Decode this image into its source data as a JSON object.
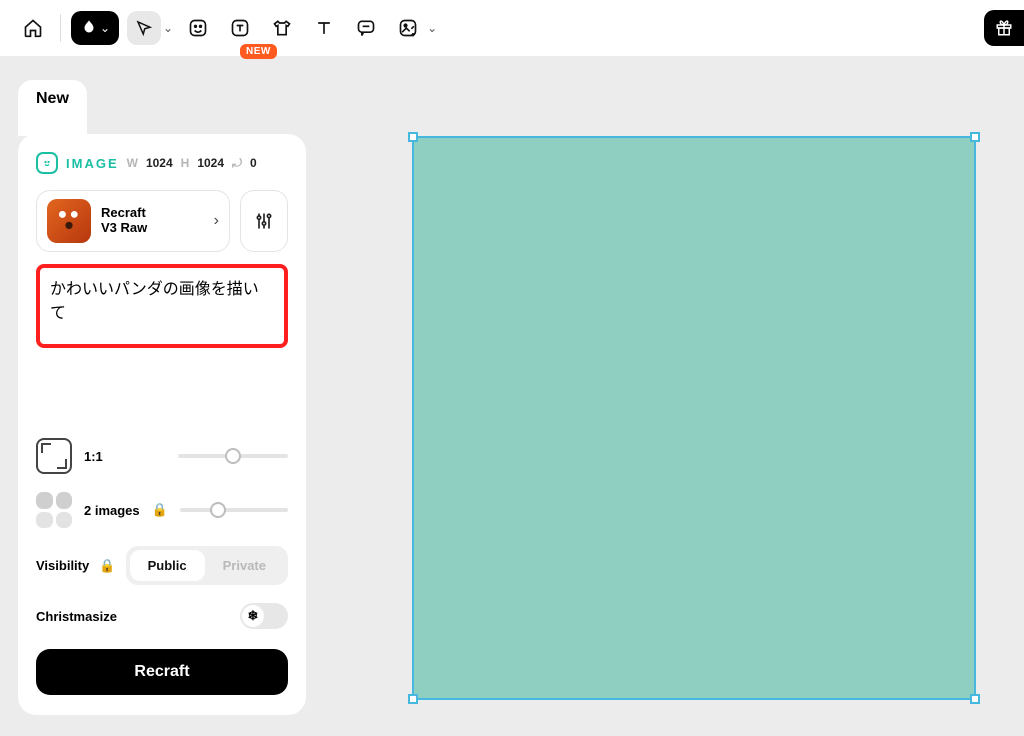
{
  "toolbar": {
    "new_badge": "NEW"
  },
  "tab": {
    "label": "New"
  },
  "panel": {
    "meta": {
      "type_label": "IMAGE",
      "w_label": "W",
      "w_value": "1024",
      "h_label": "H",
      "h_value": "1024",
      "r_label": "⟲",
      "r_value": "0"
    },
    "model": {
      "name_line1": "Recraft",
      "name_line2": "V3 Raw"
    },
    "prompt": "かわいいパンダの画像を描いて",
    "ratio": {
      "label": "1:1"
    },
    "count": {
      "label": "2 images"
    },
    "visibility": {
      "label": "Visibility",
      "public": "Public",
      "private": "Private"
    },
    "christmasize": {
      "label": "Christmasize"
    },
    "go": "Recraft"
  },
  "canvas": {
    "color": "#8ecfc1"
  }
}
